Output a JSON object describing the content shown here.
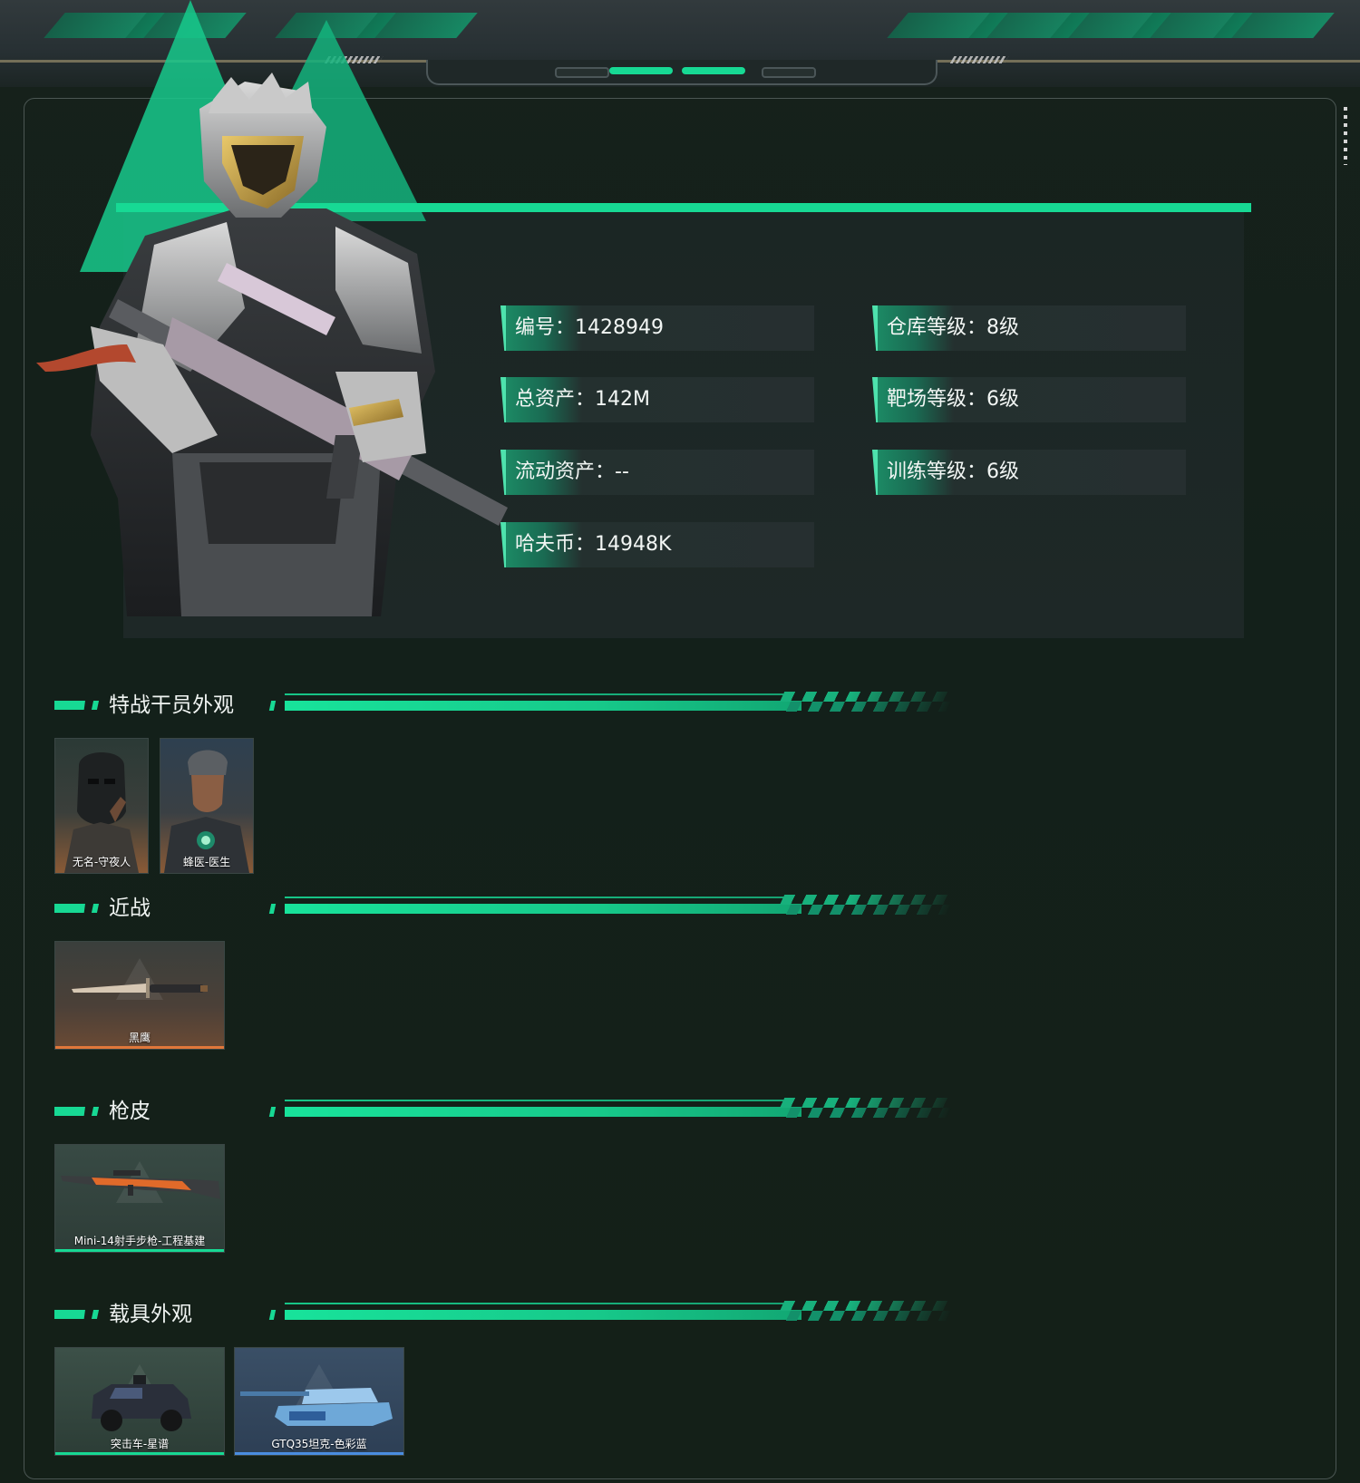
{
  "profile": {
    "stats": [
      {
        "label": "编号",
        "value": "1428949"
      },
      {
        "label": "仓库等级",
        "value": "8级"
      },
      {
        "label": "总资产",
        "value": "142M"
      },
      {
        "label": "靶场等级",
        "value": "6级"
      },
      {
        "label": "流动资产",
        "value": "--"
      },
      {
        "label": "训练等级",
        "value": "6级"
      },
      {
        "label": "哈夫币",
        "value": "14948K"
      }
    ],
    "separator": "："
  },
  "sections": {
    "operators": {
      "title": "特战干员外观",
      "items": [
        {
          "name": "无名-守夜人"
        },
        {
          "name": "蜂医-医生"
        }
      ]
    },
    "melee": {
      "title": "近战",
      "items": [
        {
          "name": "黑鹰"
        }
      ]
    },
    "gunskins": {
      "title": "枪皮",
      "items": [
        {
          "name": "Mini-14射手步枪-工程基建"
        }
      ]
    },
    "vehicles": {
      "title": "载具外观",
      "items": [
        {
          "name": "突击车-星谱"
        },
        {
          "name": "GTQ35坦克-色彩蓝"
        }
      ]
    }
  },
  "colors": {
    "accent": "#17d994",
    "background": "#142018",
    "melee_strip": "#e0773a",
    "vehicle_blue_strip": "#4a8de0"
  }
}
